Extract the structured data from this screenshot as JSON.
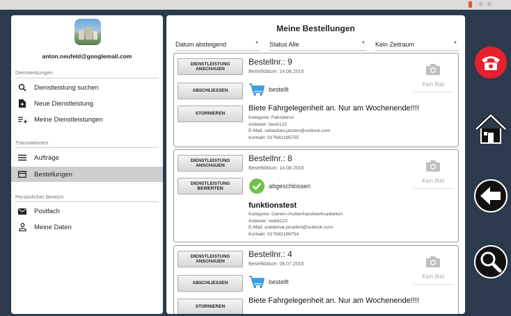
{
  "colors": {
    "accent_red": "#e8202d",
    "panel_bg": "#2b3a4c",
    "active_item": "#cfcfcf"
  },
  "drawer": {
    "email": "anton.neufeld@googlemail.com",
    "sections": [
      {
        "title": "Diensteistungen",
        "items": [
          {
            "label": "Dienstleistung suchen",
            "icon": "search-icon"
          },
          {
            "label": "Neue Dienstleistung",
            "icon": "new-document-icon"
          },
          {
            "label": "Meine Dienstleistungen",
            "icon": "list-add-icon"
          }
        ]
      },
      {
        "title": "Transaktionen",
        "items": [
          {
            "label": "Aufträge",
            "icon": "list-icon"
          },
          {
            "label": "Bestellungen",
            "icon": "card-icon",
            "active": true
          }
        ]
      },
      {
        "title": "Persönlicher Bereich",
        "items": [
          {
            "label": "Postfach",
            "icon": "mail-icon"
          },
          {
            "label": "Meine Daten",
            "icon": "person-icon"
          }
        ]
      }
    ]
  },
  "main": {
    "title": "Meine Bestellungen",
    "filters": {
      "sort": "Datum absteigend",
      "status": "Status Alle",
      "time": "Kein Zeitraum"
    },
    "orders": [
      {
        "btn1": "DIENSTLEISTUNG ANSCHAUEN",
        "btn2": "ABSCHLIESSEN",
        "btn3": "STORNIEREN",
        "number": "Bestellnr.: 9",
        "date": "Bestelldatum: 14.08.2016",
        "status": "bestellt",
        "status_icon": "cart-icon",
        "title": "Biete Fahrgelegenheit an. Nur am Wochenende!!!!",
        "kategorie": "Kategorie: Fahrdienst",
        "anbieter": "Anbieter: basti123",
        "email": "E-Mail: sebastian.janzen@outlook.com",
        "kontakt": "Kontakt: 017682186755",
        "no_image": "Kein Bild"
      },
      {
        "btn1": "DIENSTLEISTUNG ANSCHAUEN",
        "btn2": "DIENSTLEISTUNG BEWERTEN",
        "number": "Bestellnr.: 8",
        "date": "Bestelldatum: 14.08.2016",
        "status": "abgeschlossen",
        "status_icon": "check-circle-icon",
        "title": "funktionstest",
        "kategorie": "Kategorie: Garten-/Außenhandwerksarbeiten",
        "anbieter": "Anbieter: waldi123",
        "email": "E-Mail: waldemar.pruefert@outlook.com",
        "kontakt": "Kontakt: 017682186754",
        "no_image": "Kein Bild"
      },
      {
        "btn1": "DIENSTLEISTUNG ANSCHAUEN",
        "btn2": "ABSCHLIESSEN",
        "btn3": "STORNIEREN",
        "number": "Bestellnr.: 4",
        "date": "Bestelldatum: 06.07.2016",
        "status": "bestellt",
        "status_icon": "cart-icon",
        "title": "Biete Fahrgelegenheit an. Nur am Wochenende!!!!",
        "no_image": "Kein Bild"
      }
    ]
  },
  "sidebar_right": [
    {
      "icon": "phone-icon"
    },
    {
      "icon": "home-icon"
    },
    {
      "icon": "back-arrow-icon"
    },
    {
      "icon": "magnifier-icon"
    }
  ]
}
